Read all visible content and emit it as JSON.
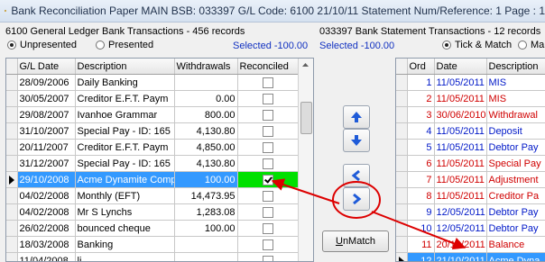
{
  "window": {
    "title": "Bank Reconciliation Paper MAIN BSB: 033397 G/L Code: 6100 21/10/11 Statement Num/Reference: 1 Page : 1"
  },
  "left": {
    "header": "6100 General Ledger Bank Transactions - 456 records",
    "radio_unpresented": "Unpresented",
    "radio_presented": "Presented",
    "selected_text": "Selected -100.00",
    "columns": [
      "G/L Date",
      "Description",
      "Withdrawals",
      "Reconciled"
    ],
    "rows": [
      {
        "date": "28/09/2006",
        "desc": "Daily Banking",
        "amount": "",
        "reconciled": false
      },
      {
        "date": "30/05/2007",
        "desc": "Creditor E.F.T. Paym",
        "amount": "0.00",
        "reconciled": false
      },
      {
        "date": "29/08/2007",
        "desc": "Ivanhoe Grammar",
        "amount": "800.00",
        "reconciled": false
      },
      {
        "date": "31/10/2007",
        "desc": "Special Pay - ID: 165",
        "amount": "4,130.80",
        "reconciled": false
      },
      {
        "date": "20/11/2007",
        "desc": "Creditor E.F.T. Paym",
        "amount": "4,850.00",
        "reconciled": false
      },
      {
        "date": "31/12/2007",
        "desc": "Special Pay - ID: 165",
        "amount": "4,130.80",
        "reconciled": false
      },
      {
        "date": "29/10/2008",
        "desc": "Acme Dynamite Comp",
        "amount": "100.00",
        "reconciled": true,
        "selected": true
      },
      {
        "date": "04/02/2008",
        "desc": "Monthly (EFT)",
        "amount": "14,473.95",
        "reconciled": false
      },
      {
        "date": "04/02/2008",
        "desc": "Mr S Lynchs",
        "amount": "1,283.08",
        "reconciled": false
      },
      {
        "date": "26/02/2008",
        "desc": "bounced cheque",
        "amount": "100.00",
        "reconciled": false
      },
      {
        "date": "18/03/2008",
        "desc": "Banking",
        "amount": "",
        "reconciled": false
      },
      {
        "date": "11/04/2008",
        "desc": "li",
        "amount": "",
        "reconciled": false
      }
    ]
  },
  "middle": {
    "unmatch_label": "UnMatch",
    "icons": [
      "arrow-up-icon",
      "arrow-down-icon",
      "chevron-left-icon",
      "chevron-right-icon"
    ]
  },
  "right": {
    "header": "033397 Bank Statement Transactions - 12 records",
    "selected_text": "Selected -100.00",
    "radio_tick": "Tick & Match",
    "radio_ma": "Ma",
    "columns": [
      "Ord",
      "Date",
      "Description"
    ],
    "rows": [
      {
        "ord": "1",
        "date": "11/05/2011",
        "desc": "MIS",
        "color": "blue"
      },
      {
        "ord": "2",
        "date": "11/05/2011",
        "desc": "MIS",
        "color": "red"
      },
      {
        "ord": "3",
        "date": "30/06/2010",
        "desc": "Withdrawal",
        "color": "red"
      },
      {
        "ord": "4",
        "date": "11/05/2011",
        "desc": "Deposit",
        "color": "blue"
      },
      {
        "ord": "5",
        "date": "11/05/2011",
        "desc": "Debtor Pay",
        "color": "blue"
      },
      {
        "ord": "6",
        "date": "11/05/2011",
        "desc": "Special Pay",
        "color": "red"
      },
      {
        "ord": "7",
        "date": "11/05/2011",
        "desc": "Adjustment",
        "color": "red"
      },
      {
        "ord": "8",
        "date": "11/05/2011",
        "desc": "Creditor Pa",
        "color": "red"
      },
      {
        "ord": "9",
        "date": "12/05/2011",
        "desc": "Debtor Pay",
        "color": "blue"
      },
      {
        "ord": "10",
        "date": "12/05/2011",
        "desc": "Debtor Pay",
        "color": "blue"
      },
      {
        "ord": "11",
        "date": "20/10/2011",
        "desc": "Balance",
        "color": "red"
      },
      {
        "ord": "12",
        "date": "21/10/2011",
        "desc": "Acme Dyna",
        "color": "white",
        "selected": true
      }
    ]
  },
  "colors": {
    "selection": "#3399ff",
    "reconciled_green": "#00e000",
    "annotation_red": "#dd0000",
    "text_red": "#d00000",
    "text_blue": "#0018c8"
  }
}
